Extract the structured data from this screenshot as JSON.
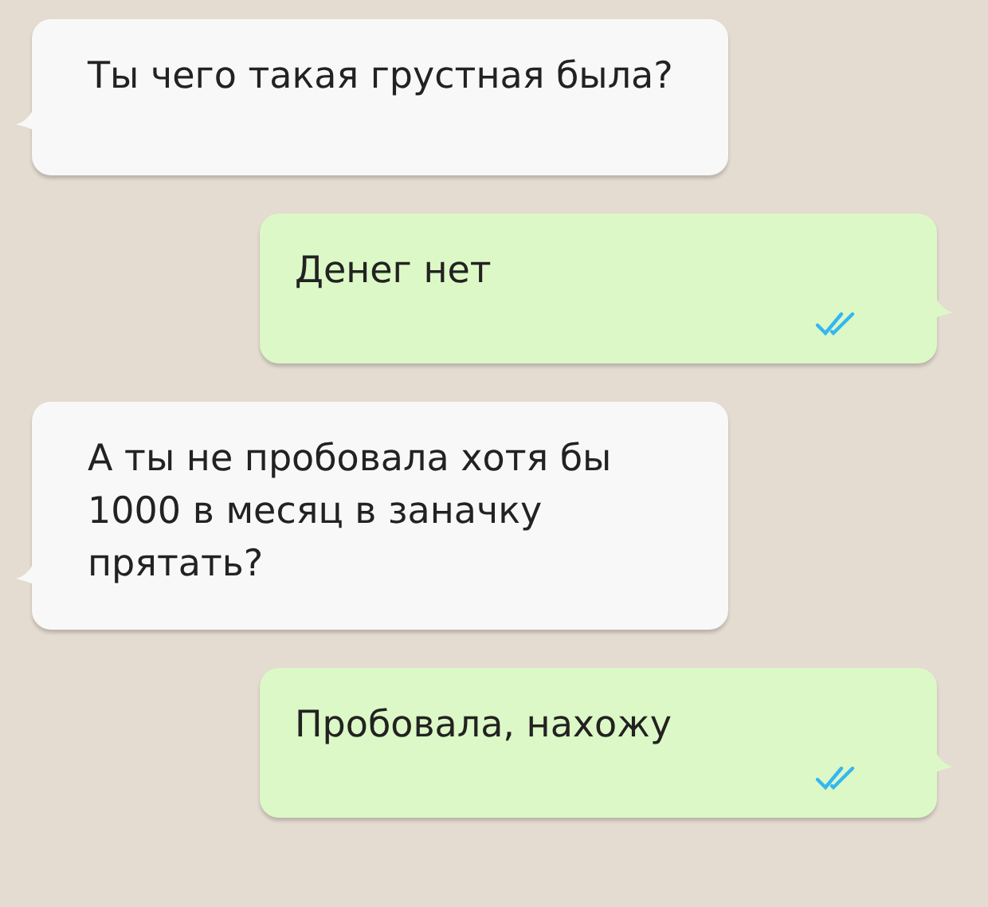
{
  "messages": [
    {
      "kind": "incoming",
      "text": "Ты чего такая грустная была?"
    },
    {
      "kind": "outgoing",
      "text": "Денег нет",
      "read": true
    },
    {
      "kind": "incoming",
      "text": "А ты не пробовала хотя бы 1000 в месяц в заначку прятать?"
    },
    {
      "kind": "outgoing",
      "text": "Пробовала, нахожу",
      "read": true
    }
  ]
}
